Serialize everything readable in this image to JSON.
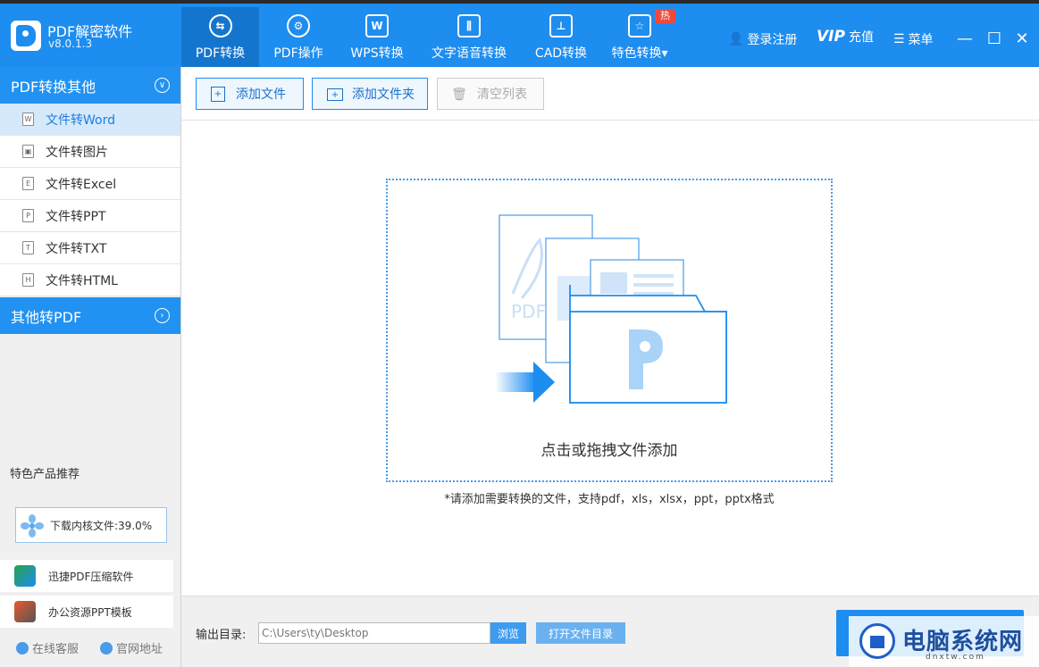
{
  "app": {
    "name": "PDF解密软件",
    "version": "v8.0.1.3"
  },
  "nav": {
    "tabs": [
      {
        "label": "PDF转换",
        "icon": "convert-icon"
      },
      {
        "label": "PDF操作",
        "icon": "settings-icon"
      },
      {
        "label": "WPS转换",
        "icon": "wps-icon"
      },
      {
        "label": "文字语音转换",
        "icon": "audio-icon"
      },
      {
        "label": "CAD转换",
        "icon": "cad-icon"
      },
      {
        "label": "特色转换",
        "icon": "star-icon"
      }
    ],
    "hot_badge": "热"
  },
  "header_right": {
    "login": "登录注册",
    "vip_logo": "VIP",
    "vip_text": "充值",
    "menu": "菜单"
  },
  "sidebar": {
    "group1": "PDF转换其他",
    "items": [
      {
        "label": "文件转Word",
        "icon": "W"
      },
      {
        "label": "文件转图片",
        "icon": "▣"
      },
      {
        "label": "文件转Excel",
        "icon": "E"
      },
      {
        "label": "文件转PPT",
        "icon": "P"
      },
      {
        "label": "文件转TXT",
        "icon": "T"
      },
      {
        "label": "文件转HTML",
        "icon": "H"
      }
    ],
    "group2": "其他转PDF",
    "recommend_title": "特色产品推荐",
    "download_status": "下载内核文件:39.0%",
    "recommend_items": [
      "迅捷PDF压缩软件",
      "办公资源PPT模板"
    ],
    "online_service": "在线客服",
    "website": "官网地址"
  },
  "toolbar": {
    "add_file": "添加文件",
    "add_folder": "添加文件夹",
    "clear_list": "清空列表"
  },
  "main": {
    "drop_text": "点击或拖拽文件添加",
    "support_text": "*请添加需要转换的文件，支持pdf，xls，xlsx，ppt，pptx格式",
    "illus_text": "PDF"
  },
  "footer": {
    "output_label": "输出目录:",
    "output_path": "C:\\Users\\ty\\Desktop",
    "browse": "浏览",
    "open_dir": "打开文件目录"
  },
  "watermark": {
    "text": "电脑系统网",
    "sub": "dnxtw.com"
  },
  "colors": {
    "brand": "#1d8df0",
    "brand_dark": "#1475cf",
    "hot": "#f2483a"
  }
}
